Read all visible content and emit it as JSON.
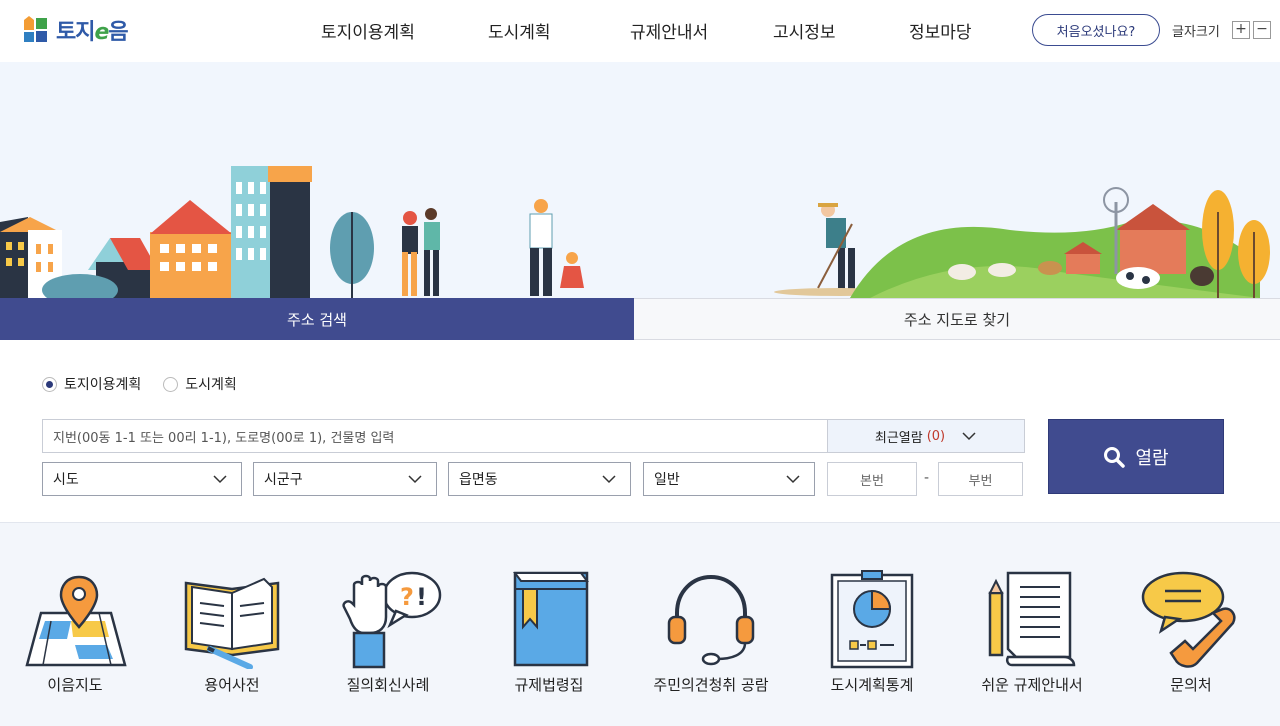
{
  "header": {
    "logo_text_1": "토지",
    "logo_text_2": "e",
    "logo_text_3": "음",
    "nav": [
      "토지이용계획",
      "도시계획",
      "규제안내서",
      "고시정보",
      "정보마당"
    ],
    "first_visit_label": "처음오셨나요?",
    "font_size_label": "글자크기",
    "font_plus": "+",
    "font_minus": "−"
  },
  "search": {
    "tab_active": "주소 검색",
    "tab_inactive": "주소 지도로 찾기",
    "radios": [
      "토지이용계획",
      "도시계획"
    ],
    "selected_radio": "토지이용계획",
    "address_placeholder": "지번(00동 1-1 또는 00리 1-1), 도로명(00로 1), 건물명 입력",
    "recent_label": "최근열람",
    "recent_count": "(0)",
    "selects": [
      "시도",
      "시군구",
      "읍면동",
      "일반"
    ],
    "main_no_placeholder": "본번",
    "sub_no_placeholder": "부번",
    "dash": "-",
    "search_button": "열람"
  },
  "quick_menu": [
    {
      "label": "이음지도",
      "icon": "map-pin-icon"
    },
    {
      "label": "용어사전",
      "icon": "open-book-icon"
    },
    {
      "label": "질의회신사례",
      "icon": "raised-hand-question-icon"
    },
    {
      "label": "규제법령집",
      "icon": "law-book-icon"
    },
    {
      "label": "주민의견청취 공람",
      "icon": "headset-icon"
    },
    {
      "label": "도시계획통계",
      "icon": "pie-chart-board-icon"
    },
    {
      "label": "쉬운 규제안내서",
      "icon": "document-pencil-icon"
    },
    {
      "label": "문의처",
      "icon": "phone-speech-icon"
    }
  ],
  "colors": {
    "primary": "#404b8f",
    "hero_bg": "#f1f6fd",
    "quick_bg": "#f3f6fb",
    "accent_orange": "#f59a3e",
    "accent_yellow": "#f7c948",
    "accent_blue": "#5aa9e6"
  }
}
